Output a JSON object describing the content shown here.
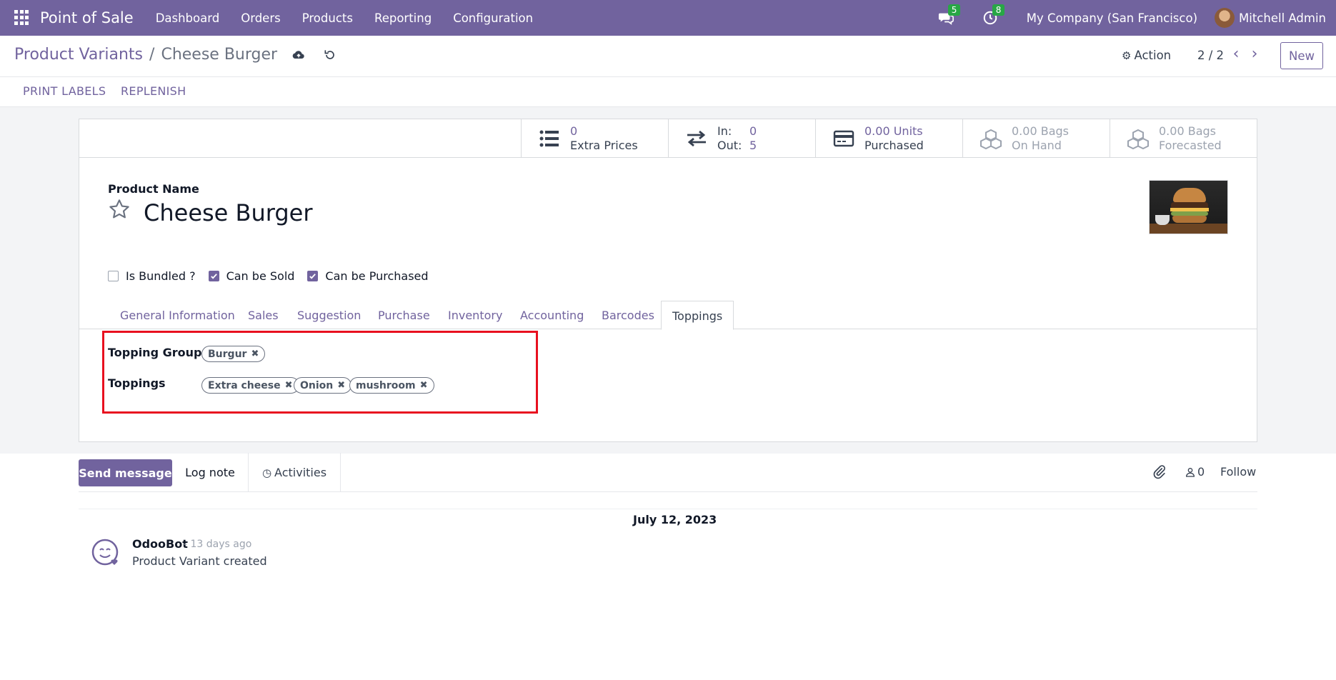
{
  "navbar": {
    "app_name": "Point of Sale",
    "menu": [
      "Dashboard",
      "Orders",
      "Products",
      "Reporting",
      "Configuration"
    ],
    "messages_badge": "5",
    "activities_badge": "8",
    "company": "My Company (San Francisco)",
    "user": "Mitchell Admin",
    "bg_color": "#71639e"
  },
  "control": {
    "breadcrumb_parent": "Product Variants",
    "breadcrumb_sep": "/",
    "breadcrumb_current": "Cheese Burger",
    "action_label": "Action",
    "pager": "2 / 2",
    "new_label": "New"
  },
  "statusbar": {
    "print_labels": "PRINT LABELS",
    "replenish": "REPLENISH"
  },
  "smart_buttons": {
    "extra_prices": {
      "value": "0",
      "label": "Extra Prices"
    },
    "in_out": {
      "in_label": "In:",
      "in_value": "0",
      "out_label": "Out:",
      "out_value": "5"
    },
    "purchased": {
      "value": "0.00 Units",
      "label": "Purchased"
    },
    "on_hand": {
      "value": "0.00 Bags",
      "label": "On Hand"
    },
    "forecasted": {
      "value": "0.00 Bags",
      "label": "Forecasted"
    }
  },
  "form": {
    "product_name_label": "Product Name",
    "product_name": "Cheese Burger",
    "checkboxes": [
      {
        "label": "Is Bundled ?",
        "checked": false
      },
      {
        "label": "Can be Sold",
        "checked": true
      },
      {
        "label": "Can be Purchased",
        "checked": true
      }
    ],
    "tabs": [
      "General Information",
      "Sales",
      "Suggestion",
      "Purchase",
      "Inventory",
      "Accounting",
      "Barcodes",
      "Toppings"
    ],
    "active_tab": "Toppings",
    "topping_group_label": "Topping Group",
    "topping_group_tags": [
      "Burgur"
    ],
    "toppings_label": "Toppings",
    "toppings_tags": [
      "Extra cheese",
      "Onion",
      "mushroom"
    ],
    "highlight_color": "#e8101f"
  },
  "chatter": {
    "send_message": "Send message",
    "log_note": "Log note",
    "activities": "Activities",
    "followers_count": "0",
    "follow": "Follow",
    "date": "July 12, 2023",
    "message": {
      "author": "OdooBot",
      "time": "- 13 days ago",
      "body": "Product Variant created"
    }
  }
}
